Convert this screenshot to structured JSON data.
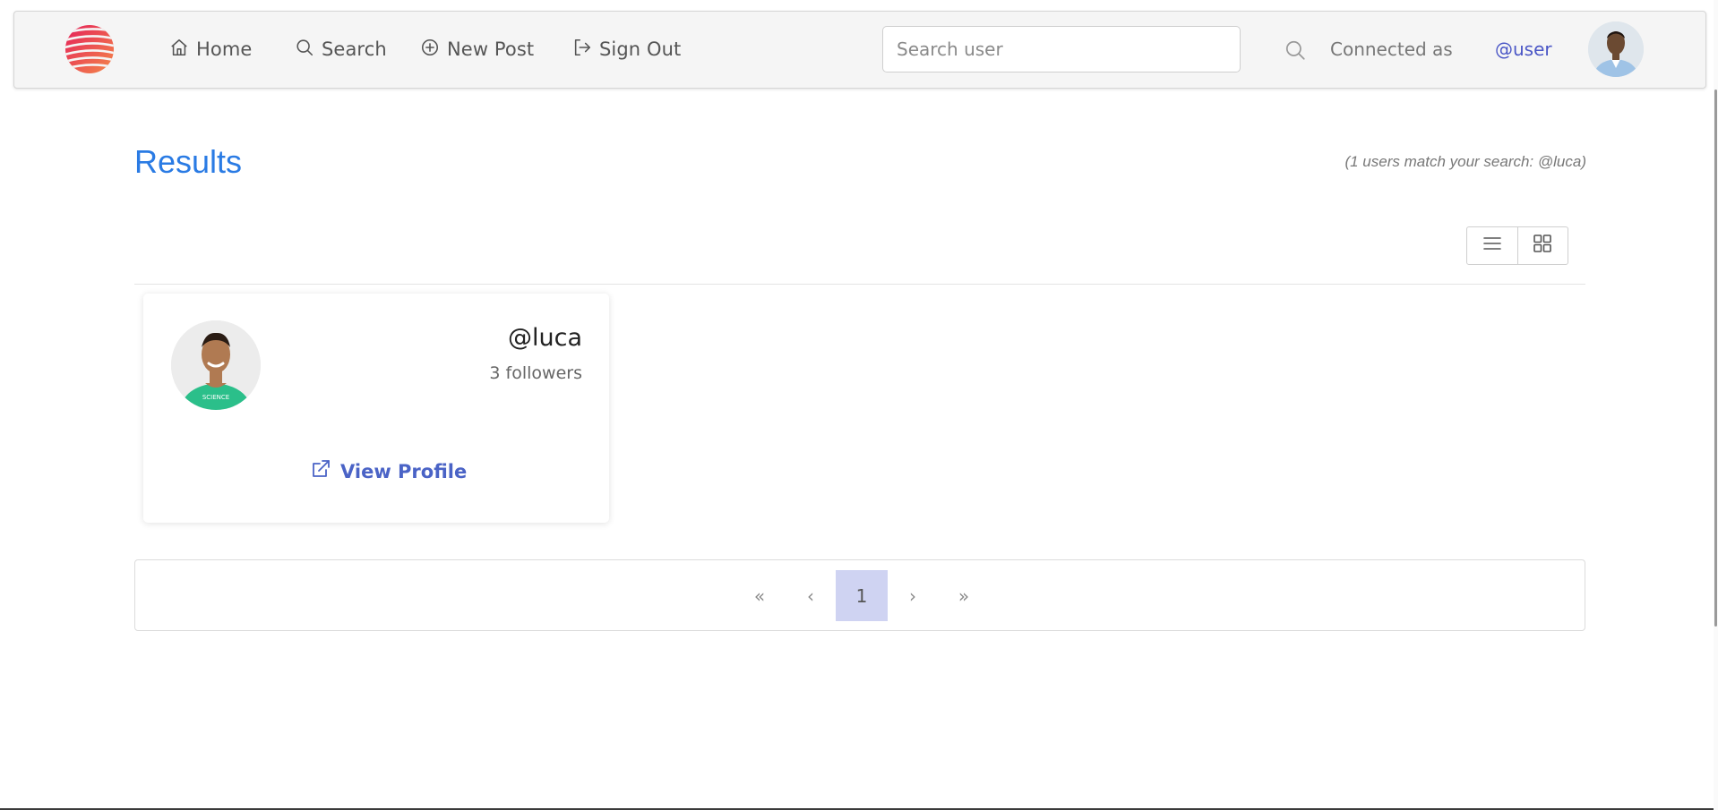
{
  "nav": {
    "home": "Home",
    "search": "Search",
    "new_post": "New Post",
    "sign_out": "Sign Out",
    "search_placeholder": "Search user",
    "connected_as": "Connected as",
    "username": "@user"
  },
  "results": {
    "title": "Results",
    "count_text": "(1 users match your search: @luca)"
  },
  "users": [
    {
      "handle": "@luca",
      "followers": "3 followers",
      "view_profile": "View Profile"
    }
  ],
  "pagination": {
    "first": "«",
    "prev": "‹",
    "current": "1",
    "next": "›",
    "last": "»"
  },
  "colors": {
    "accent": "#2a7be4",
    "link": "#4a63c6",
    "page_active_bg": "#cfd3f2"
  },
  "icons": {
    "home": "home-icon",
    "search": "search-icon",
    "new_post": "plus-circle-icon",
    "sign_out": "sign-out-icon",
    "list_view": "list-view-icon",
    "grid_view": "grid-view-icon",
    "external": "external-link-icon"
  }
}
